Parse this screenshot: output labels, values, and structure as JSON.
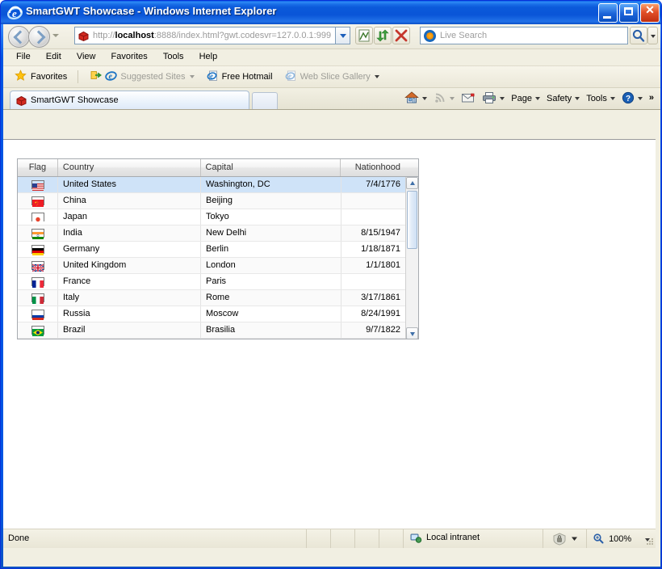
{
  "window": {
    "title": "SmartGWT Showcase - Windows Internet Explorer",
    "icon": "ie-logo-icon",
    "controls": {
      "minimize": "minimize-button",
      "maximize": "maximize-button",
      "close": "close-button"
    }
  },
  "navbar": {
    "back_tooltip": "Back",
    "forward_tooltip": "Forward",
    "address_url_prefix": "http://",
    "address_url_host": "localhost",
    "address_url_rest": ":8888/index.html?gwt.codesvr=127.0.0.1:999",
    "address_full": "http://localhost:8888/index.html?gwt.codesvr=127.0.0.1:999",
    "buttons": [
      "compatibility-view",
      "refresh",
      "stop"
    ],
    "search": {
      "placeholder": "Live Search",
      "value": "",
      "provider_icon": "bing-icon"
    }
  },
  "menubar": {
    "items": [
      {
        "label": "File"
      },
      {
        "label": "Edit"
      },
      {
        "label": "View"
      },
      {
        "label": "Favorites"
      },
      {
        "label": "Tools"
      },
      {
        "label": "Help"
      }
    ]
  },
  "favbar": {
    "favorites_label": "Favorites",
    "items": [
      {
        "label": "Suggested Sites",
        "dim": true,
        "caret": true
      },
      {
        "label": "Free Hotmail",
        "dim": false,
        "caret": false
      },
      {
        "label": "Web Slice Gallery",
        "dim": true,
        "caret": true
      }
    ]
  },
  "tabs": {
    "active": {
      "label": "SmartGWT Showcase",
      "icon": "smartgwt-icon"
    },
    "new_tab_label": ""
  },
  "commandbar": {
    "items": [
      {
        "label": "",
        "icon": "home-icon",
        "caret": true
      },
      {
        "label": "",
        "icon": "feeds-icon",
        "caret": true,
        "dim": true
      },
      {
        "label": "",
        "icon": "mail-icon",
        "caret": false
      },
      {
        "label": "",
        "icon": "print-icon",
        "caret": true
      },
      {
        "label": "Page",
        "icon": "",
        "caret": true
      },
      {
        "label": "Safety",
        "icon": "",
        "caret": true
      },
      {
        "label": "Tools",
        "icon": "",
        "caret": true
      },
      {
        "label": "",
        "icon": "help-icon",
        "caret": true
      }
    ],
    "overflow": "»"
  },
  "grid": {
    "columns": [
      {
        "key": "flag",
        "label": "Flag",
        "align": "center"
      },
      {
        "key": "country",
        "label": "Country",
        "align": "left"
      },
      {
        "key": "capital",
        "label": "Capital",
        "align": "left"
      },
      {
        "key": "nationhood",
        "label": "Nationhood",
        "align": "right"
      }
    ],
    "rows": [
      {
        "flag_icon": "flag-us",
        "country": "United States",
        "capital": "Washington, DC",
        "nationhood": "7/4/1776",
        "selected": true
      },
      {
        "flag_icon": "flag-cn",
        "country": "China",
        "capital": "Beijing",
        "nationhood": "",
        "selected": false
      },
      {
        "flag_icon": "flag-jp",
        "country": "Japan",
        "capital": "Tokyo",
        "nationhood": "",
        "selected": false
      },
      {
        "flag_icon": "flag-in",
        "country": "India",
        "capital": "New Delhi",
        "nationhood": "8/15/1947",
        "selected": false
      },
      {
        "flag_icon": "flag-de",
        "country": "Germany",
        "capital": "Berlin",
        "nationhood": "1/18/1871",
        "selected": false
      },
      {
        "flag_icon": "flag-uk",
        "country": "United Kingdom",
        "capital": "London",
        "nationhood": "1/1/1801",
        "selected": false
      },
      {
        "flag_icon": "flag-fr",
        "country": "France",
        "capital": "Paris",
        "nationhood": "",
        "selected": false
      },
      {
        "flag_icon": "flag-it",
        "country": "Italy",
        "capital": "Rome",
        "nationhood": "3/17/1861",
        "selected": false
      },
      {
        "flag_icon": "flag-ru",
        "country": "Russia",
        "capital": "Moscow",
        "nationhood": "8/24/1991",
        "selected": false
      },
      {
        "flag_icon": "flag-br",
        "country": "Brazil",
        "capital": "Brasilia",
        "nationhood": "9/7/1822",
        "selected": false
      }
    ]
  },
  "statusbar": {
    "status": "Done",
    "zone": "Local intranet",
    "zoom": "100%"
  },
  "colors": {
    "titlebar_blue": "#0054e3",
    "selection_blue": "#cfe3f8",
    "chrome_beige": "#f1efe2",
    "grid_border": "#a7abb0"
  }
}
